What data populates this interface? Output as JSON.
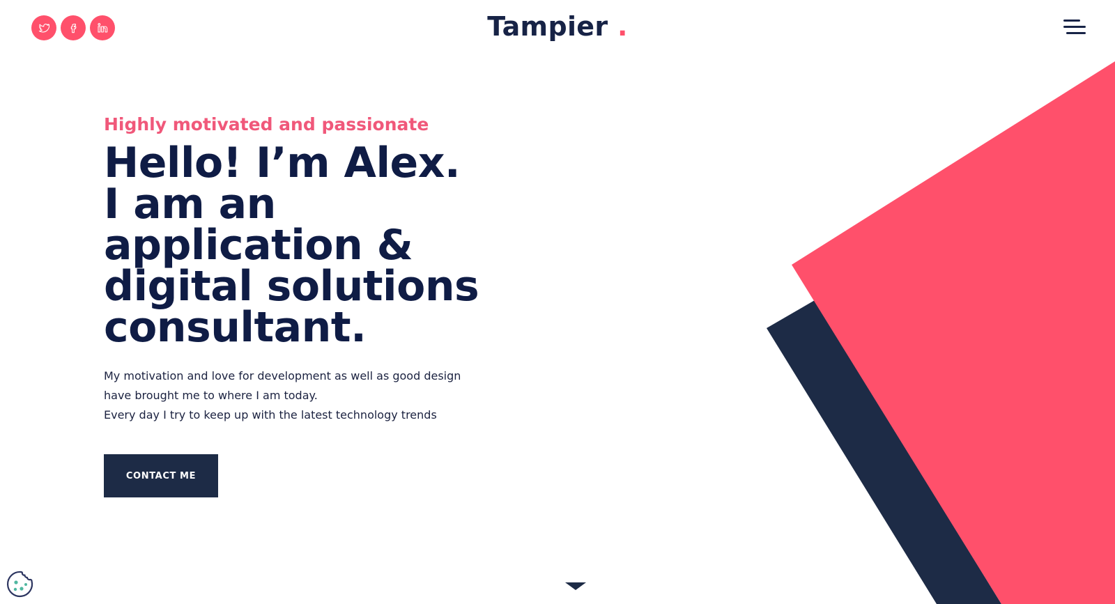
{
  "header": {
    "logo_text": "Tampier",
    "logo_dot": ".",
    "social": [
      {
        "name": "twitter-icon"
      },
      {
        "name": "facebook-icon"
      },
      {
        "name": "linkedin-icon"
      }
    ]
  },
  "hero": {
    "subtitle": "Highly motivated and passionate",
    "headline": "Hello! I’m Alex. I am an application & digital solutions consultant.",
    "description_lines": [
      "My motivation and love for development as well as good design",
      "have brought me to where I am today.",
      "Every day I try to keep up with the latest technology trends"
    ],
    "cta_label": "CONTACT ME"
  },
  "colors": {
    "accent": "#ff506b",
    "navy": "#1d2b46",
    "headline": "#0f1c45",
    "background": "#ffffff"
  },
  "icons": {
    "menu": "hamburger-menu-icon",
    "cookie": "cookie-icon",
    "scroll": "chevron-down-icon"
  }
}
